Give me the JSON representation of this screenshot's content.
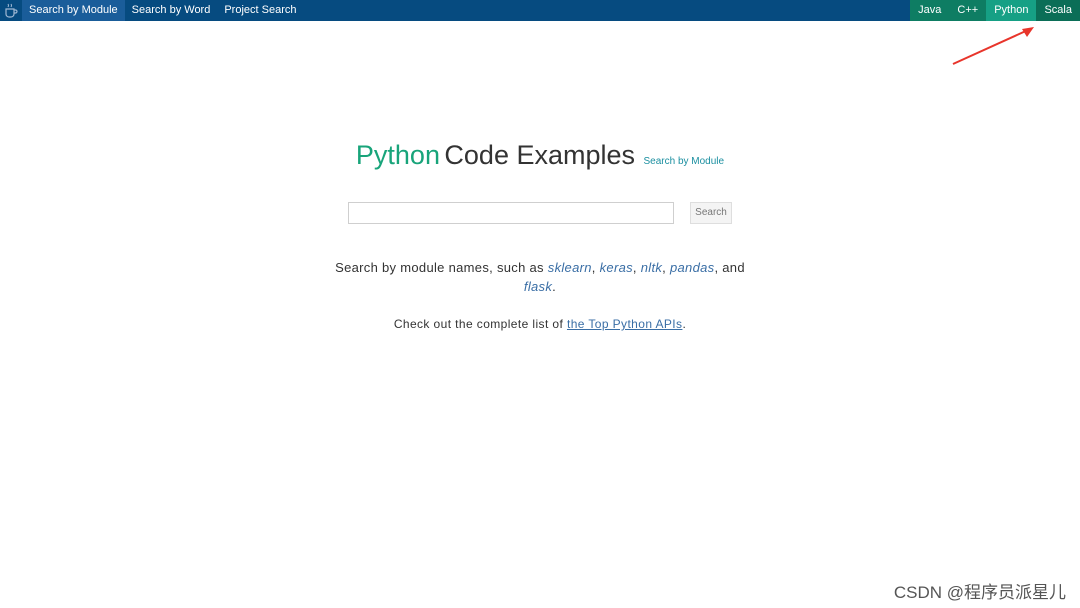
{
  "nav": {
    "items": [
      {
        "label": "Search by Module"
      },
      {
        "label": "Search by Word"
      },
      {
        "label": "Project Search"
      }
    ]
  },
  "languages": [
    {
      "label": "Java"
    },
    {
      "label": "C++"
    },
    {
      "label": "Python"
    },
    {
      "label": "Scala"
    }
  ],
  "heading": {
    "highlight": "Python",
    "rest": "Code Examples",
    "sub_link": "Search by Module"
  },
  "search": {
    "value": "",
    "button": "Search"
  },
  "description": {
    "prefix": "Search by module names, such as ",
    "m1": "sklearn",
    "sep1": ", ",
    "m2": "keras",
    "sep2": ", ",
    "m3": "nltk",
    "sep3": ", ",
    "m4": "pandas",
    "sep4": ", and ",
    "m5": "flask",
    "suffix": "."
  },
  "toplist": {
    "prefix": "Check out the complete list of ",
    "link": "the Top Python APIs",
    "suffix": "."
  },
  "watermark": "CSDN @程序员派星儿",
  "colors": {
    "topbar": "#064b80",
    "python_green": "#18a47a",
    "link_blue": "#3a6ea5",
    "arrow_red": "#e8352b"
  }
}
